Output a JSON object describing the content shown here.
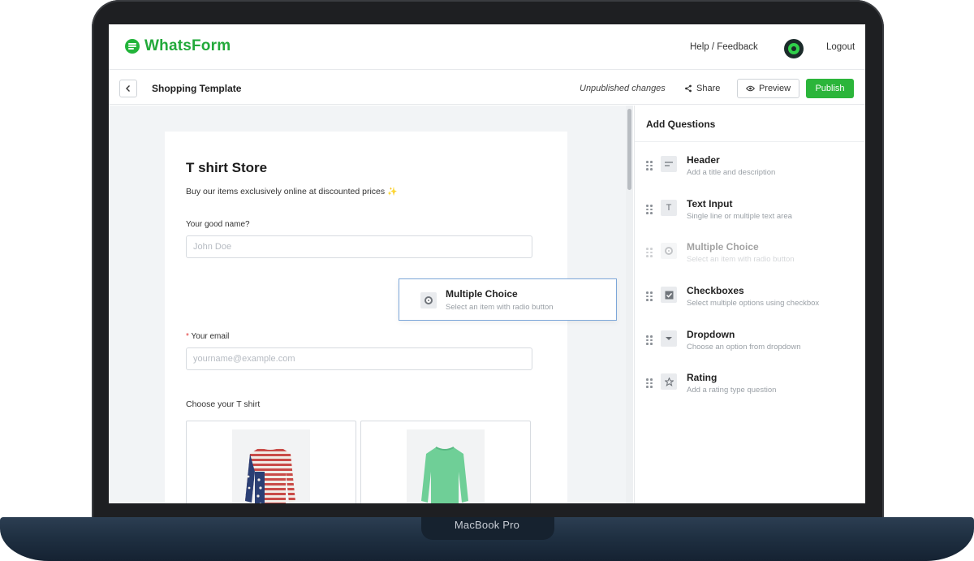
{
  "device": {
    "label": "MacBook Pro"
  },
  "topbar": {
    "brand": "WhatsForm",
    "help_feedback": "Help / Feedback",
    "logout": "Logout"
  },
  "subbar": {
    "title": "Shopping Template",
    "status": "Unpublished changes",
    "share_label": "Share",
    "preview_label": "Preview",
    "publish_label": "Publish"
  },
  "form": {
    "title": "T shirt Store",
    "description": "Buy our items exclusively online at discounted prices",
    "fields": [
      {
        "label": "Your good name?",
        "placeholder": "John Doe",
        "required": false
      },
      {
        "label": "Your email",
        "placeholder": "yourname@example.com",
        "required": true
      }
    ],
    "choice_label": "Choose your T shirt"
  },
  "drag_ghost": {
    "name": "Multiple Choice",
    "desc": "Select an item with radio button"
  },
  "panel": {
    "title": "Add Questions",
    "items": [
      {
        "name": "Header",
        "desc": "Add a title and description",
        "icon": "header-icon",
        "dimmed": false
      },
      {
        "name": "Text Input",
        "desc": "Single line or multiple text area",
        "icon": "text-input-icon",
        "dimmed": false
      },
      {
        "name": "Multiple Choice",
        "desc": "Select an item with radio button",
        "icon": "radio-icon",
        "dimmed": true
      },
      {
        "name": "Checkboxes",
        "desc": "Select multiple options using checkbox",
        "icon": "checkbox-icon",
        "dimmed": false
      },
      {
        "name": "Dropdown",
        "desc": "Choose an option from dropdown",
        "icon": "dropdown-icon",
        "dimmed": false
      },
      {
        "name": "Rating",
        "desc": "Add a rating type question",
        "icon": "star-icon",
        "dimmed": false
      }
    ]
  },
  "colors": {
    "brand": "#22a93a",
    "publish": "#2bb53a",
    "drag_border": "#7da7d9",
    "required": "#e23b3b"
  }
}
